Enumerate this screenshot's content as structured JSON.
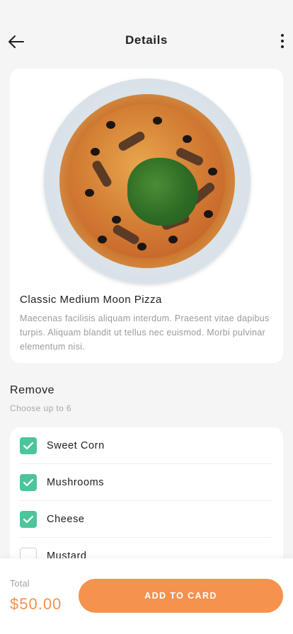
{
  "header": {
    "title": "Details",
    "back_icon": "arrow-left-icon",
    "more_icon": "more-vertical-icon"
  },
  "product": {
    "image_name": "pizza-image",
    "name": "Classic Medium Moon Pizza",
    "description": "Maecenas facilisis aliquam interdum. Praesent vitae dapibus turpis. Aliquam blandit ut tellus nec euismod. Morbi pulvinar elementum nisi."
  },
  "remove_section": {
    "title": "Remove",
    "subtitle": "Choose up to 6",
    "options": [
      {
        "label": "Sweet Corn",
        "checked": true
      },
      {
        "label": "Mushrooms",
        "checked": true
      },
      {
        "label": "Cheese",
        "checked": true
      },
      {
        "label": "Mustard",
        "checked": false
      }
    ]
  },
  "footer": {
    "total_label": "Total",
    "total_value": "$50.00",
    "add_button_label": "ADD TO CARD"
  },
  "colors": {
    "accent": "#f4924e",
    "check": "#4cc59a",
    "background": "#f5f5f5"
  }
}
